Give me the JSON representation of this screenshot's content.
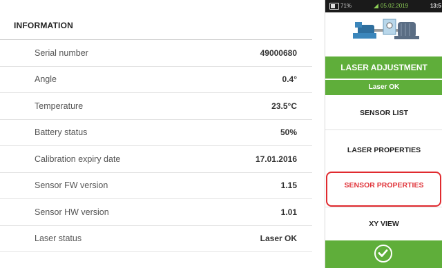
{
  "info": {
    "title": "INFORMATION",
    "rows": [
      {
        "label": "Serial number",
        "value": "49000680"
      },
      {
        "label": "Angle",
        "value": "0.4°"
      },
      {
        "label": "Temperature",
        "value": "23.5°C"
      },
      {
        "label": "Battery status",
        "value": "50%"
      },
      {
        "label": "Calibration expiry date",
        "value": "17.01.2016"
      },
      {
        "label": "Sensor FW version",
        "value": "1.15"
      },
      {
        "label": "Sensor HW version",
        "value": "1.01"
      },
      {
        "label": "Laser status",
        "value": "Laser OK"
      }
    ]
  },
  "statusbar": {
    "battery": "71%",
    "date": "05.02.2019",
    "time": "13:5"
  },
  "panel": {
    "laser_adjustment": "LASER ADJUSTMENT",
    "laser_ok": "Laser OK",
    "sensor_list": "SENSOR LIST",
    "laser_properties": "LASER PROPERTIES",
    "sensor_properties": "SENSOR PROPERTIES",
    "xy_view": "XY VIEW"
  },
  "colors": {
    "accent_green": "#5fae3a",
    "highlight_red": "#e0343a"
  }
}
